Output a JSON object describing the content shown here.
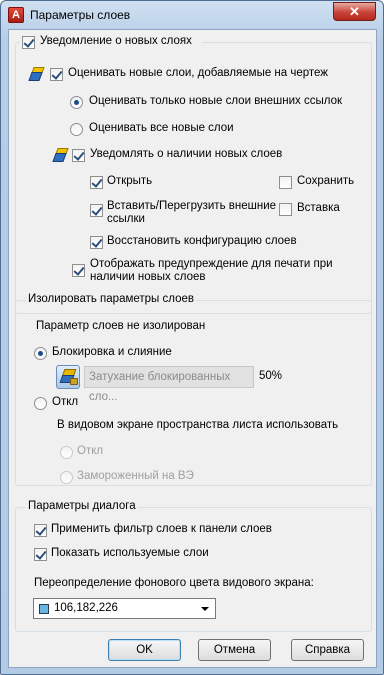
{
  "window": {
    "title": "Параметры слоев",
    "app_icon": "autocad-a-icon",
    "close_glyph": "✕"
  },
  "notify": {
    "group_label": "Уведомление о новых слоях",
    "group_checked": true,
    "evaluate_label": "Оценивать новые слои, добавляемые на чертеж",
    "evaluate_checked": true,
    "radio_xref_only": "Оценивать только новые слои внешних ссылок",
    "radio_all": "Оценивать все новые слои",
    "selected_radio": "xref_only",
    "notify_label": "Уведомлять о наличии новых слоев",
    "notify_checked": true,
    "open_label": "Открыть",
    "open_checked": true,
    "save_label": "Сохранить",
    "save_checked": false,
    "insert_reload_label_1": "Вставить/Перегрузить внешние",
    "insert_reload_label_2": "ссылки",
    "insert_reload_checked": true,
    "insert_label": "Вставка",
    "insert_checked": false,
    "restore_label": "Восстановить конфигурацию слоев",
    "restore_checked": true,
    "plot_warning_label_1": "Отображать предупреждение для печати при",
    "plot_warning_label_2": "наличии новых слоев",
    "plot_warning_checked": true
  },
  "isolate": {
    "group_label": "Изолировать параметры слоев",
    "status": "Параметр слоев не изолирован",
    "lock_fade_label": "Блокировка и слияние",
    "off_label": "Откл",
    "selected": "lock_fade",
    "fade_field_text": "Затухание блокированных сло...",
    "fade_value": "50%",
    "viewport_label": "В видовом экране пространства листа использовать",
    "vp_off_label": "Откл",
    "vp_frozen_label": "Замороженный на ВЭ"
  },
  "dialog": {
    "group_label": "Параметры диалога",
    "apply_filter_label": "Применить фильтр слоев к панели слоев",
    "apply_filter_checked": true,
    "show_used_label": "Показать используемые слои",
    "show_used_checked": true,
    "bg_override_label": "Переопределение фонового цвета видового экрана:",
    "bg_color_value": "106,182,226",
    "bg_color_hex": "#6ab6e2"
  },
  "buttons": {
    "ok": "OK",
    "cancel": "Отмена",
    "help": "Справка"
  }
}
